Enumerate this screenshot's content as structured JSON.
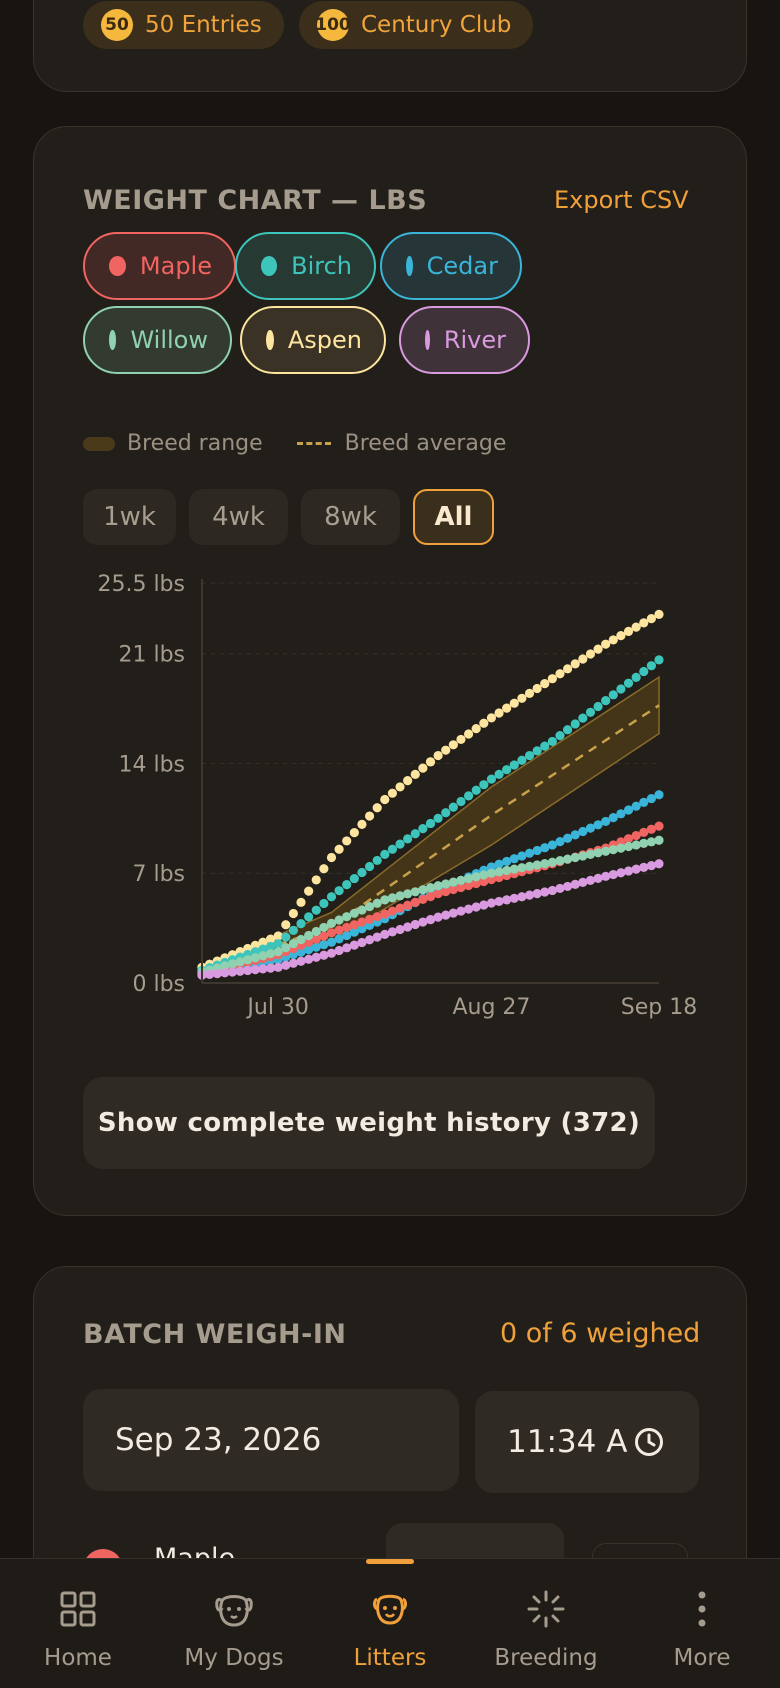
{
  "achievements": [
    {
      "coin": "50",
      "label": "50 Entries"
    },
    {
      "coin": "100",
      "label": "Century Club"
    }
  ],
  "weight_chart": {
    "title": "WEIGHT CHART — LBS",
    "export_label": "Export CSV",
    "puppies": [
      {
        "name": "Maple",
        "color": "#f06461",
        "selected": false
      },
      {
        "name": "Birch",
        "color": "#3ec5bb",
        "selected": false
      },
      {
        "name": "Cedar",
        "color": "#3ab5d9",
        "selected": false
      },
      {
        "name": "Willow",
        "color": "#8fd1b0",
        "selected": false
      },
      {
        "name": "Aspen",
        "color": "#fde5a0",
        "selected": true
      },
      {
        "name": "River",
        "color": "#d99ae0",
        "selected": false
      }
    ],
    "legend": {
      "range": "Breed range",
      "average": "Breed average"
    },
    "ranges": [
      {
        "label": "1wk",
        "active": false
      },
      {
        "label": "4wk",
        "active": false
      },
      {
        "label": "8wk",
        "active": false
      },
      {
        "label": "All",
        "active": true
      }
    ],
    "history_button": "Show complete weight history (372)"
  },
  "chart_data": {
    "type": "scatter",
    "ylim": [
      0,
      25.5
    ],
    "y_ticks": [
      {
        "value": 0,
        "label": "0 lbs"
      },
      {
        "value": 7,
        "label": "7 lbs"
      },
      {
        "value": 14,
        "label": "14 lbs"
      },
      {
        "value": 21,
        "label": "21 lbs"
      },
      {
        "value": 25.5,
        "label": "25.5 lbs"
      }
    ],
    "x_range": [
      "2026-07-20",
      "2026-09-18"
    ],
    "x_ticks": [
      {
        "date": "2026-07-30",
        "label": "Jul 30"
      },
      {
        "date": "2026-08-27",
        "label": "Aug 27"
      },
      {
        "date": "2026-09-18",
        "label": "Sep 18"
      }
    ],
    "grid": true,
    "series": [
      {
        "name": "Aspen",
        "color": "#fde5a0",
        "points": [
          [
            "2026-07-20",
            1.0
          ],
          [
            "2026-07-30",
            3.0
          ],
          [
            "2026-08-06",
            8.0
          ],
          [
            "2026-08-13",
            11.7
          ],
          [
            "2026-08-20",
            14.5
          ],
          [
            "2026-08-27",
            16.9
          ],
          [
            "2026-09-04",
            19.4
          ],
          [
            "2026-09-11",
            21.6
          ],
          [
            "2026-09-18",
            23.5
          ]
        ]
      },
      {
        "name": "Birch",
        "color": "#3ec5bb",
        "points": [
          [
            "2026-07-20",
            0.8
          ],
          [
            "2026-07-30",
            2.5
          ],
          [
            "2026-08-06",
            5.5
          ],
          [
            "2026-08-13",
            8.2
          ],
          [
            "2026-08-20",
            10.5
          ],
          [
            "2026-08-27",
            13.0
          ],
          [
            "2026-09-04",
            15.4
          ],
          [
            "2026-09-11",
            18.0
          ],
          [
            "2026-09-18",
            20.6
          ]
        ]
      },
      {
        "name": "Cedar",
        "color": "#3ab5d9",
        "points": [
          [
            "2026-07-20",
            0.6
          ],
          [
            "2026-07-30",
            1.5
          ],
          [
            "2026-08-06",
            2.6
          ],
          [
            "2026-08-13",
            4.1
          ],
          [
            "2026-08-20",
            5.9
          ],
          [
            "2026-08-27",
            7.4
          ],
          [
            "2026-09-04",
            8.8
          ],
          [
            "2026-09-11",
            10.3
          ],
          [
            "2026-09-18",
            12.0
          ]
        ]
      },
      {
        "name": "Maple",
        "color": "#f06461",
        "points": [
          [
            "2026-07-20",
            0.6
          ],
          [
            "2026-07-30",
            1.8
          ],
          [
            "2026-08-06",
            3.2
          ],
          [
            "2026-08-13",
            4.4
          ],
          [
            "2026-08-20",
            5.7
          ],
          [
            "2026-08-27",
            6.6
          ],
          [
            "2026-09-04",
            7.6
          ],
          [
            "2026-09-11",
            8.6
          ],
          [
            "2026-09-18",
            10.0
          ]
        ]
      },
      {
        "name": "Willow",
        "color": "#8fd1b0",
        "points": [
          [
            "2026-07-20",
            0.7
          ],
          [
            "2026-07-30",
            2.0
          ],
          [
            "2026-08-06",
            3.8
          ],
          [
            "2026-08-13",
            5.3
          ],
          [
            "2026-08-20",
            6.2
          ],
          [
            "2026-08-27",
            7.0
          ],
          [
            "2026-09-04",
            7.7
          ],
          [
            "2026-09-11",
            8.4
          ],
          [
            "2026-09-18",
            9.1
          ]
        ]
      },
      {
        "name": "River",
        "color": "#d99ae0",
        "points": [
          [
            "2026-07-20",
            0.5
          ],
          [
            "2026-07-30",
            1.0
          ],
          [
            "2026-08-06",
            1.9
          ],
          [
            "2026-08-13",
            3.1
          ],
          [
            "2026-08-20",
            4.2
          ],
          [
            "2026-08-27",
            5.1
          ],
          [
            "2026-09-04",
            5.9
          ],
          [
            "2026-09-11",
            6.8
          ],
          [
            "2026-09-18",
            7.6
          ]
        ]
      }
    ],
    "breed_range": {
      "color": "#4a3a1a",
      "x": [
        "2026-07-20",
        "2026-08-06",
        "2026-08-27",
        "2026-09-18"
      ],
      "low": [
        0.6,
        2.7,
        8.8,
        15.9
      ],
      "high": [
        1.0,
        4.5,
        12.5,
        19.5
      ]
    },
    "breed_average": {
      "color": "#c9a14a",
      "x": [
        "2026-07-20",
        "2026-08-06",
        "2026-08-27",
        "2026-09-18"
      ],
      "values": [
        0.8,
        3.6,
        10.7,
        17.7
      ]
    }
  },
  "batch": {
    "title": "BATCH WEIGH-IN",
    "status": "0 of 6 weighed",
    "date": "Sep 23, 2026",
    "time": "11:34 A",
    "first_puppy": "Maple"
  },
  "nav": {
    "items": [
      {
        "label": "Home",
        "icon": "grid-icon",
        "active": false
      },
      {
        "label": "My Dogs",
        "icon": "dog-face-icon",
        "active": false
      },
      {
        "label": "Litters",
        "icon": "puppy-icon",
        "active": true
      },
      {
        "label": "Breeding",
        "icon": "sparkle-icon",
        "active": false
      },
      {
        "label": "More",
        "icon": "more-vertical-icon",
        "active": false
      }
    ]
  },
  "colors": {
    "accent": "#f0a03a",
    "card": "#221e19",
    "background": "#171411"
  }
}
